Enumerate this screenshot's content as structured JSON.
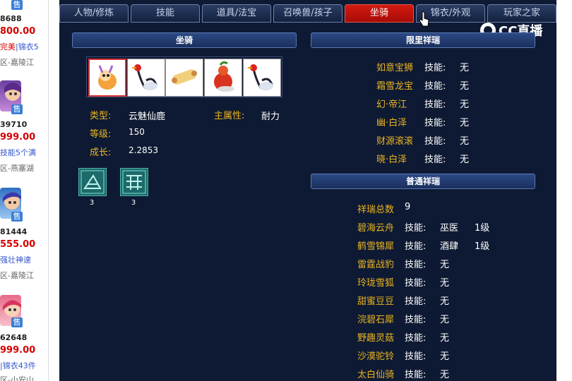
{
  "sidebar": {
    "cards": [
      {
        "num": "8688",
        "price": "800.00",
        "desc_red": "完美",
        "desc_rest": "|锦衣5",
        "server": "区-嘉陵江"
      },
      {
        "num": "39710",
        "price": "999.00",
        "desc_red": "",
        "desc_rest": "技能5个满",
        "server": "区-燕塞湖"
      },
      {
        "num": "81444",
        "price": "555.00",
        "desc_red": "",
        "desc_rest": "强壮神速",
        "server": "区-嘉陵江"
      },
      {
        "num": "62648",
        "price": "999.00",
        "desc_red": "",
        "desc_rest": "|锦衣43件",
        "server": "区-小安山"
      }
    ],
    "sell_label": "售"
  },
  "tabs": [
    {
      "label": "人物/修炼"
    },
    {
      "label": "技能"
    },
    {
      "label": "道具/法宝"
    },
    {
      "label": "召唤兽/孩子"
    },
    {
      "label": "坐骑"
    },
    {
      "label": "锦衣/外观"
    },
    {
      "label": "玩家之家"
    }
  ],
  "watermark": "CC直播",
  "mount": {
    "header": "坐骑",
    "type_label": "类型:",
    "type_value": "云魅仙鹿",
    "attr_label": "主属性:",
    "attr_value": "耐力",
    "level_label": "等级:",
    "level_value": "150",
    "growth_label": "成长:",
    "growth_value": "2.2853",
    "gems": [
      {
        "count": "3"
      },
      {
        "count": "3"
      }
    ]
  },
  "limited": {
    "header": "限里祥瑞",
    "items": [
      {
        "name": "如意宝狮",
        "skill_label": "技能:",
        "skill": "无"
      },
      {
        "name": "霜雪龙宝",
        "skill_label": "技能:",
        "skill": "无"
      },
      {
        "name": "幻·帝江",
        "skill_label": "技能:",
        "skill": "无"
      },
      {
        "name": "幽·白泽",
        "skill_label": "技能:",
        "skill": "无"
      },
      {
        "name": "财源滚滚",
        "skill_label": "技能:",
        "skill": "无"
      },
      {
        "name": "晓·白泽",
        "skill_label": "技能:",
        "skill": "无"
      }
    ]
  },
  "normal": {
    "header": "普通祥瑞",
    "total_label": "祥瑞总数",
    "total_value": "9",
    "items": [
      {
        "name": "碧海云舟",
        "skill_label": "技能:",
        "skill": "巫医",
        "level": "1级"
      },
      {
        "name": "鹤雪锦犀",
        "skill_label": "技能:",
        "skill": "酒肆",
        "level": "1级"
      },
      {
        "name": "雷霆战豹",
        "skill_label": "技能:",
        "skill": "无",
        "level": ""
      },
      {
        "name": "玲珑雪狐",
        "skill_label": "技能:",
        "skill": "无",
        "level": ""
      },
      {
        "name": "甜蜜豆豆",
        "skill_label": "技能:",
        "skill": "无",
        "level": ""
      },
      {
        "name": "浣碧石犀",
        "skill_label": "技能:",
        "skill": "无",
        "level": ""
      },
      {
        "name": "野趣灵菇",
        "skill_label": "技能:",
        "skill": "无",
        "level": ""
      },
      {
        "name": "沙漠驼铃",
        "skill_label": "技能:",
        "skill": "无",
        "level": ""
      },
      {
        "name": "太白仙骑",
        "skill_label": "技能:",
        "skill": "无",
        "level": ""
      }
    ]
  }
}
